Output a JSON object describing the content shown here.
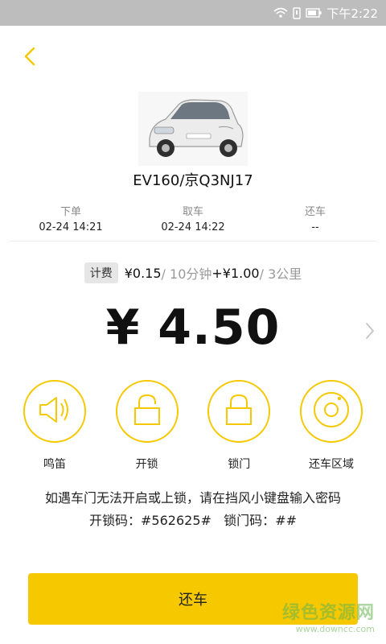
{
  "status": {
    "time": "下午2:22"
  },
  "car": {
    "name": "EV160/京Q3NJ17"
  },
  "timeline": [
    {
      "label": "下单",
      "value": "02-24 14:21"
    },
    {
      "label": "取车",
      "value": "02-24 14:22"
    },
    {
      "label": "还车",
      "value": "--"
    }
  ],
  "rate": {
    "badge": "计费",
    "time_price": "¥0.15",
    "time_unit": "/ 10分钟",
    "plus": "+",
    "km_price": "¥1.00",
    "km_unit": "/ 3公里"
  },
  "price": {
    "amount": "¥ 4.50"
  },
  "actions": [
    {
      "label": "鸣笛",
      "icon": "horn-icon"
    },
    {
      "label": "开锁",
      "icon": "unlock-icon"
    },
    {
      "label": "锁门",
      "icon": "lock-icon"
    },
    {
      "label": "还车区域",
      "icon": "return-area-icon"
    }
  ],
  "notice": {
    "line1": "如遇车门无法开启或上锁，请在挡风小键盘输入密码",
    "unlock_label": "开锁码：",
    "unlock_code": "#562625#",
    "lock_label": "锁门码：",
    "lock_code": "##"
  },
  "return_button": {
    "label": "还车"
  },
  "watermark": {
    "line1": "绿色资源网",
    "line2": "www.downcc.com"
  },
  "colors": {
    "accent": "#f5c800",
    "statusbar": "#bdbdbd"
  }
}
